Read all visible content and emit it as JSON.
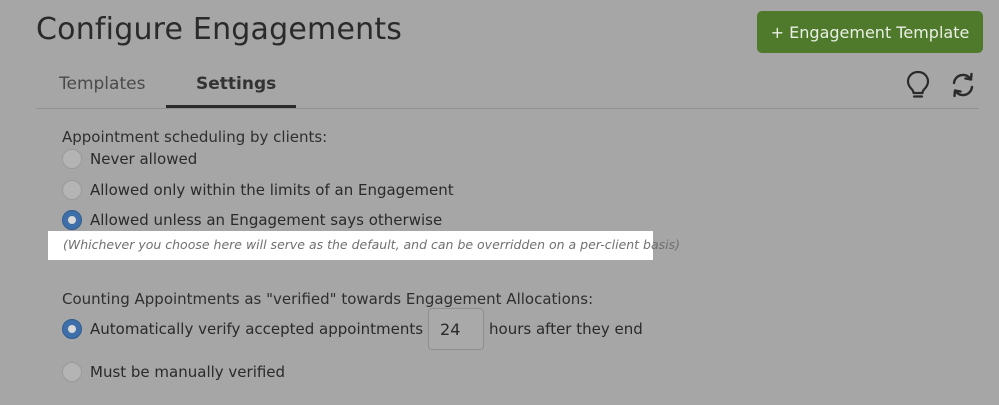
{
  "header": {
    "title": "Configure Engagements",
    "add_template_label": "+ Engagement Template"
  },
  "tabs": [
    {
      "label": "Templates",
      "active": false
    },
    {
      "label": "Settings",
      "active": true
    }
  ],
  "toolbar_icons": [
    "lightbulb-icon",
    "refresh-icon"
  ],
  "scheduling": {
    "label": "Appointment scheduling by clients:",
    "options": [
      {
        "label": "Never allowed",
        "checked": false
      },
      {
        "label": "Allowed only within the limits of an Engagement",
        "checked": false
      },
      {
        "label": "Allowed unless an Engagement says otherwise",
        "checked": true
      }
    ],
    "hint": "(Whichever you choose here will serve as the default, and can be overridden on a per-client basis)"
  },
  "verification": {
    "label": "Counting Appointments as \"verified\" towards Engagement Allocations:",
    "auto_prefix": "Automatically verify accepted appointments",
    "hours_value": "24",
    "auto_suffix": "hours after they end",
    "auto_checked": true,
    "manual_label": "Must be manually verified",
    "manual_checked": false
  },
  "colors": {
    "accent_green": "#4f7a2b",
    "radio_selected": "#3e6fa8",
    "overlay_background": "#a6a6a6",
    "highlight": "#ffffff"
  }
}
